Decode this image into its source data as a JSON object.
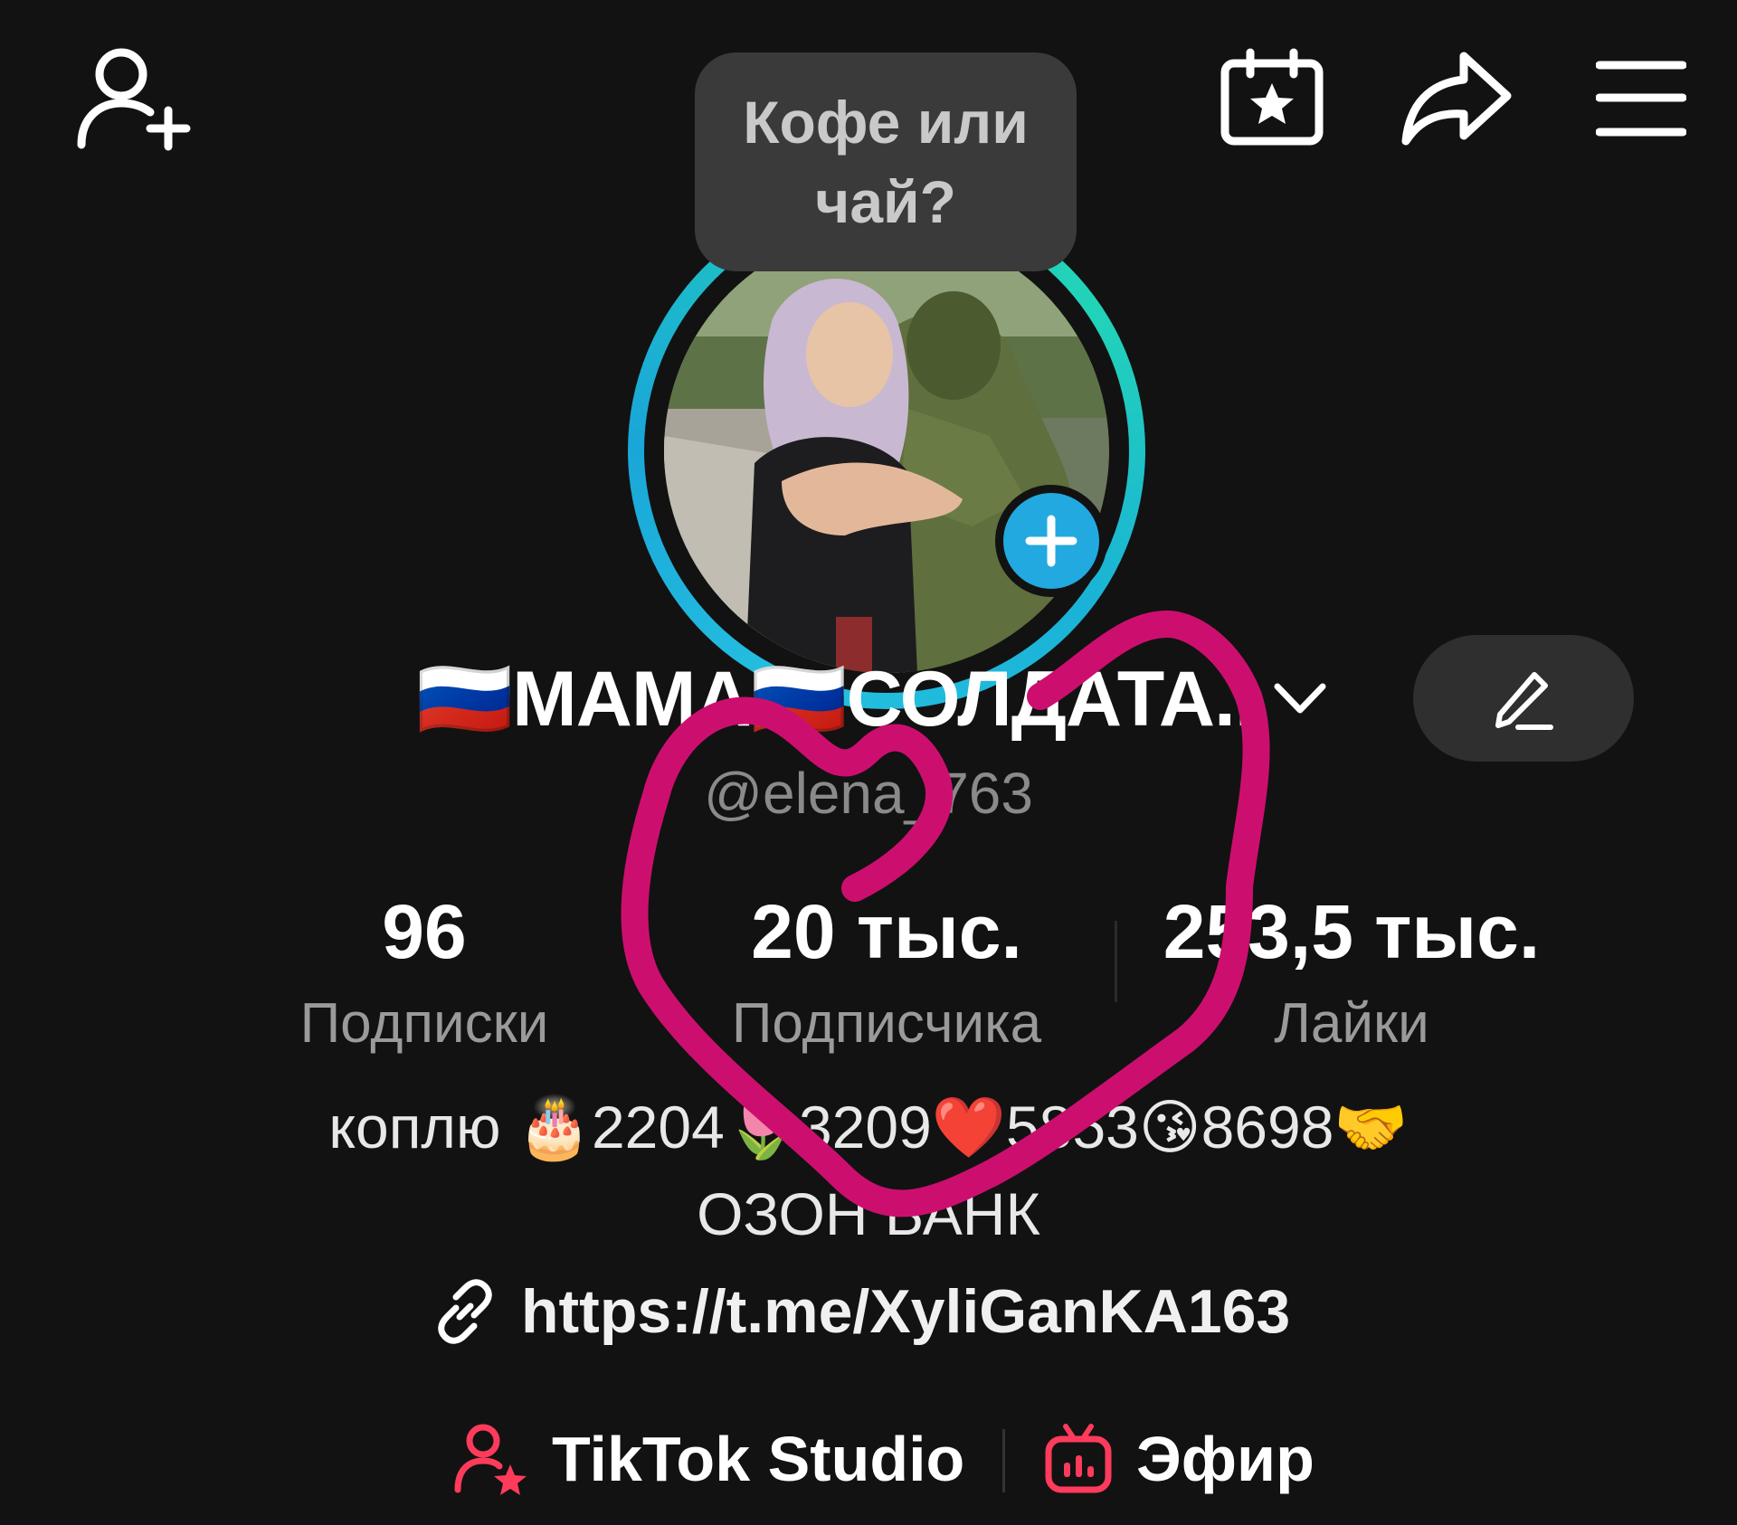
{
  "header": {
    "note": "Кофе или чай?"
  },
  "profile": {
    "display_name": "🇷🇺МАМА🇷🇺СОЛДАТА..",
    "username": "@elena_763",
    "bio_line1": "коплю 🎂2204🌷3209❤️5853😘8698🤝",
    "bio_line2": "ОЗОН БАНК",
    "link": "https://t.me/XyliGanKA163"
  },
  "stats": [
    {
      "value": "96",
      "label": "Подписки"
    },
    {
      "value": "20 тыс.",
      "label": "Подписчика"
    },
    {
      "value": "253,5 тыс.",
      "label": "Лайки"
    }
  ],
  "bottom": {
    "studio_label": "TikTok Studio",
    "live_label": "Эфир"
  },
  "colors": {
    "background": "#121212",
    "avatar_ring": "#25c1e0",
    "add_badge": "#22a9e0",
    "overlay_heart": "#cc0f6f",
    "studio_accent": "#ff3b5c"
  }
}
